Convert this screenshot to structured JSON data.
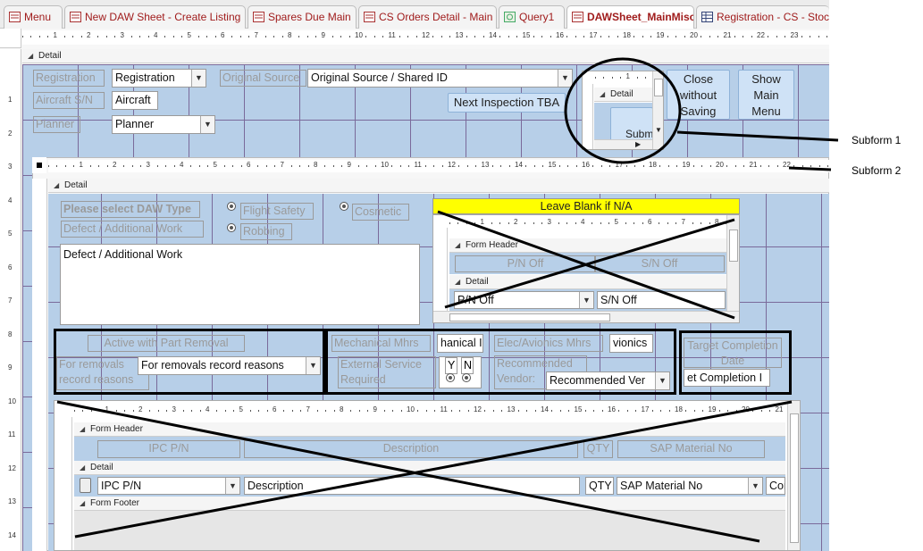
{
  "tabs": [
    {
      "label": "Menu",
      "active": false
    },
    {
      "label": "New DAW Sheet - Create Listing",
      "active": false
    },
    {
      "label": "Spares Due Main",
      "active": false
    },
    {
      "label": "CS Orders Detail - Main",
      "active": false
    },
    {
      "label": "Query1",
      "active": false
    },
    {
      "label": "DAWSheet_MainMisc",
      "active": true
    },
    {
      "label": "Registration - CS - Stoc",
      "active": false
    }
  ],
  "main_section": "Detail",
  "header": {
    "registration_label": "Registration",
    "registration_value": "Registration",
    "aircraft_label": "Aircraft S/N",
    "aircraft_value": "Aircraft",
    "planner_label": "Planner",
    "planner_value": "Planner",
    "original_source_label": "Original Source",
    "original_source_value": "Original Source / Shared ID",
    "next_inspection_button": "Next Inspection TBA",
    "close_button": "Close without Saving",
    "show_main_button": "Show Main Menu"
  },
  "subform1": {
    "section": "Detail",
    "button_partial": "Subm",
    "callout": "Subform 1"
  },
  "subform2": {
    "callout": "Subform 2",
    "section": "Detail",
    "daw_type_label": "Please select DAW Type",
    "defect_label": "Defect / Additional Work",
    "defect_value": "Defect / Additional Work",
    "options": [
      "Flight Safety",
      "Cosmetic",
      "Robbing"
    ],
    "leave_blank_banner": "Leave Blank if N/A",
    "inner_form_header": "Form Header",
    "inner_detail": "Detail",
    "pn_off_label": "P/N Off",
    "sn_off_label": "S/N Off",
    "pn_off_value": "P/N Off",
    "sn_off_value": "S/N Off",
    "active_part_removal": "Active with Part Removal",
    "removals_label": "For removals record reasons",
    "removals_value": "For removals record reasons",
    "mech_mhrs_label": "Mechanical Mhrs",
    "mech_mhrs_value": "hanical I",
    "external_service_label": "External Service Required",
    "yn": [
      "Y",
      "N"
    ],
    "elec_label": "Elec/Avionics Mhrs",
    "elec_value": "vionics",
    "vendor_label": "Recommended Vendor:",
    "vendor_value": "Recommended Ver",
    "target_label": "Target Completion Date",
    "target_value": "et Completion I"
  },
  "parts_subform": {
    "form_header": "Form Header",
    "detail": "Detail",
    "form_footer": "Form Footer",
    "columns": [
      "IPC P/N",
      "Description",
      "QTY",
      "SAP Material No"
    ],
    "row": {
      "ipc": "IPC P/N",
      "description": "Description",
      "qty": "QTY",
      "sap": "SAP Material No",
      "extra": "Com"
    }
  },
  "ruler_numbers_top": [
    "1",
    "2",
    "3",
    "4",
    "5",
    "6",
    "7",
    "8",
    "9",
    "10",
    "11",
    "12",
    "13",
    "14",
    "15",
    "16",
    "17",
    "18",
    "19",
    "20",
    "21",
    "22",
    "23"
  ],
  "ruler_numbers_sub2": [
    "1",
    "2",
    "3",
    "4",
    "5",
    "6",
    "7",
    "8",
    "9",
    "10",
    "11",
    "12",
    "13",
    "14",
    "15",
    "16",
    "17",
    "18",
    "19",
    "20",
    "21",
    "22"
  ],
  "ruler_numbers_parts": [
    "1",
    "2",
    "3",
    "4",
    "5",
    "6",
    "7",
    "8",
    "9",
    "10",
    "11",
    "12",
    "13",
    "14",
    "15",
    "16",
    "17",
    "18",
    "19",
    "20",
    "21"
  ],
  "ruler_numbers_left": [
    "1",
    "2",
    "3",
    "4",
    "5",
    "6",
    "7",
    "8",
    "9",
    "10",
    "11",
    "12",
    "13",
    "14"
  ]
}
